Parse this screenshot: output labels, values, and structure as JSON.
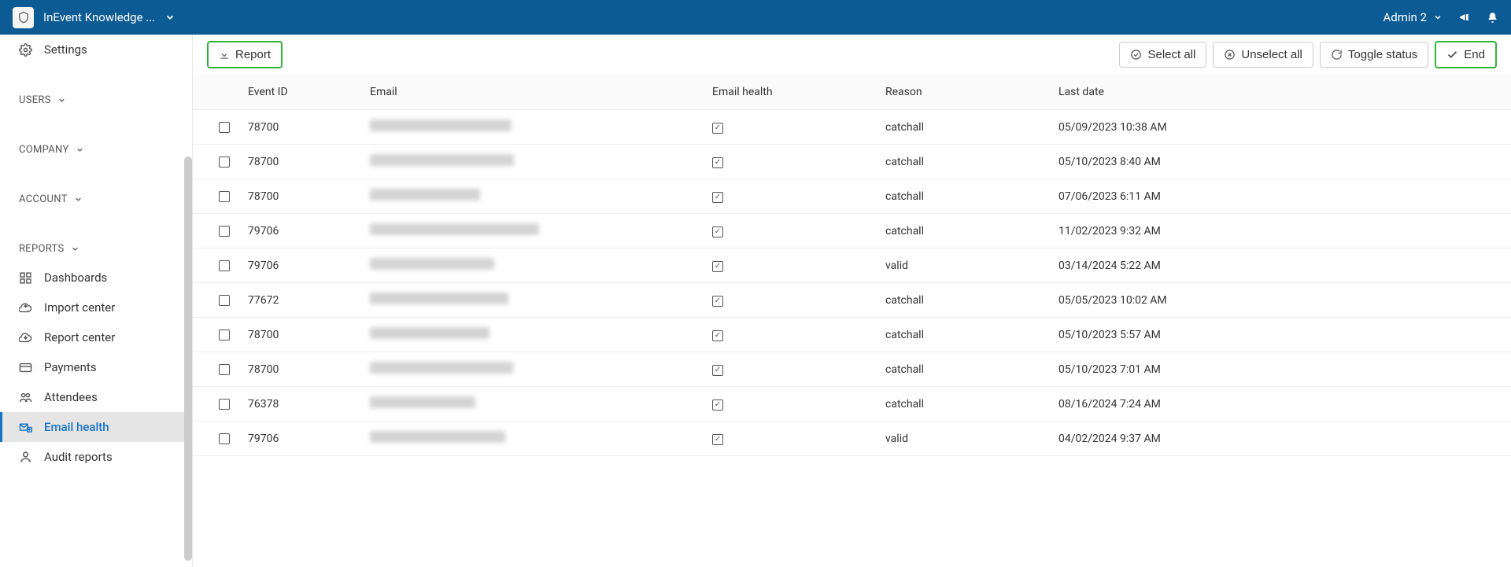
{
  "topbar": {
    "app_title": "InEvent Knowledge ...",
    "user_label": "Admin 2"
  },
  "sidebar": {
    "settings_label": "Settings",
    "groups": {
      "users": "USERS",
      "company": "COMPANY",
      "account": "ACCOUNT",
      "reports": "REPORTS"
    },
    "report_items": {
      "dashboards": "Dashboards",
      "import_center": "Import center",
      "report_center": "Report center",
      "payments": "Payments",
      "attendees": "Attendees",
      "email_health": "Email health",
      "audit_reports": "Audit reports"
    }
  },
  "toolbar": {
    "report": "Report",
    "select_all": "Select all",
    "unselect_all": "Unselect all",
    "toggle_status": "Toggle status",
    "end": "End"
  },
  "table": {
    "headers": {
      "event_id": "Event ID",
      "email": "Email",
      "email_health": "Email health",
      "reason": "Reason",
      "last_date": "Last date"
    },
    "rows": [
      {
        "event_id": "78700",
        "email_blur_w": 180,
        "reason": "catchall",
        "last_date": "05/09/2023 10:38 AM"
      },
      {
        "event_id": "78700",
        "email_blur_w": 183,
        "reason": "catchall",
        "last_date": "05/10/2023 8:40 AM"
      },
      {
        "event_id": "78700",
        "email_blur_w": 140,
        "reason": "catchall",
        "last_date": "07/06/2023 6:11 AM"
      },
      {
        "event_id": "79706",
        "email_blur_w": 215,
        "reason": "catchall",
        "last_date": "11/02/2023 9:32 AM"
      },
      {
        "event_id": "79706",
        "email_blur_w": 158,
        "reason": "valid",
        "last_date": "03/14/2024 5:22 AM"
      },
      {
        "event_id": "77672",
        "email_blur_w": 176,
        "reason": "catchall",
        "last_date": "05/05/2023 10:02 AM"
      },
      {
        "event_id": "78700",
        "email_blur_w": 152,
        "reason": "catchall",
        "last_date": "05/10/2023 5:57 AM"
      },
      {
        "event_id": "78700",
        "email_blur_w": 182,
        "reason": "catchall",
        "last_date": "05/10/2023 7:01 AM"
      },
      {
        "event_id": "76378",
        "email_blur_w": 134,
        "reason": "catchall",
        "last_date": "08/16/2024 7:24 AM"
      },
      {
        "event_id": "79706",
        "email_blur_w": 172,
        "reason": "valid",
        "last_date": "04/02/2024 9:37 AM"
      }
    ]
  }
}
